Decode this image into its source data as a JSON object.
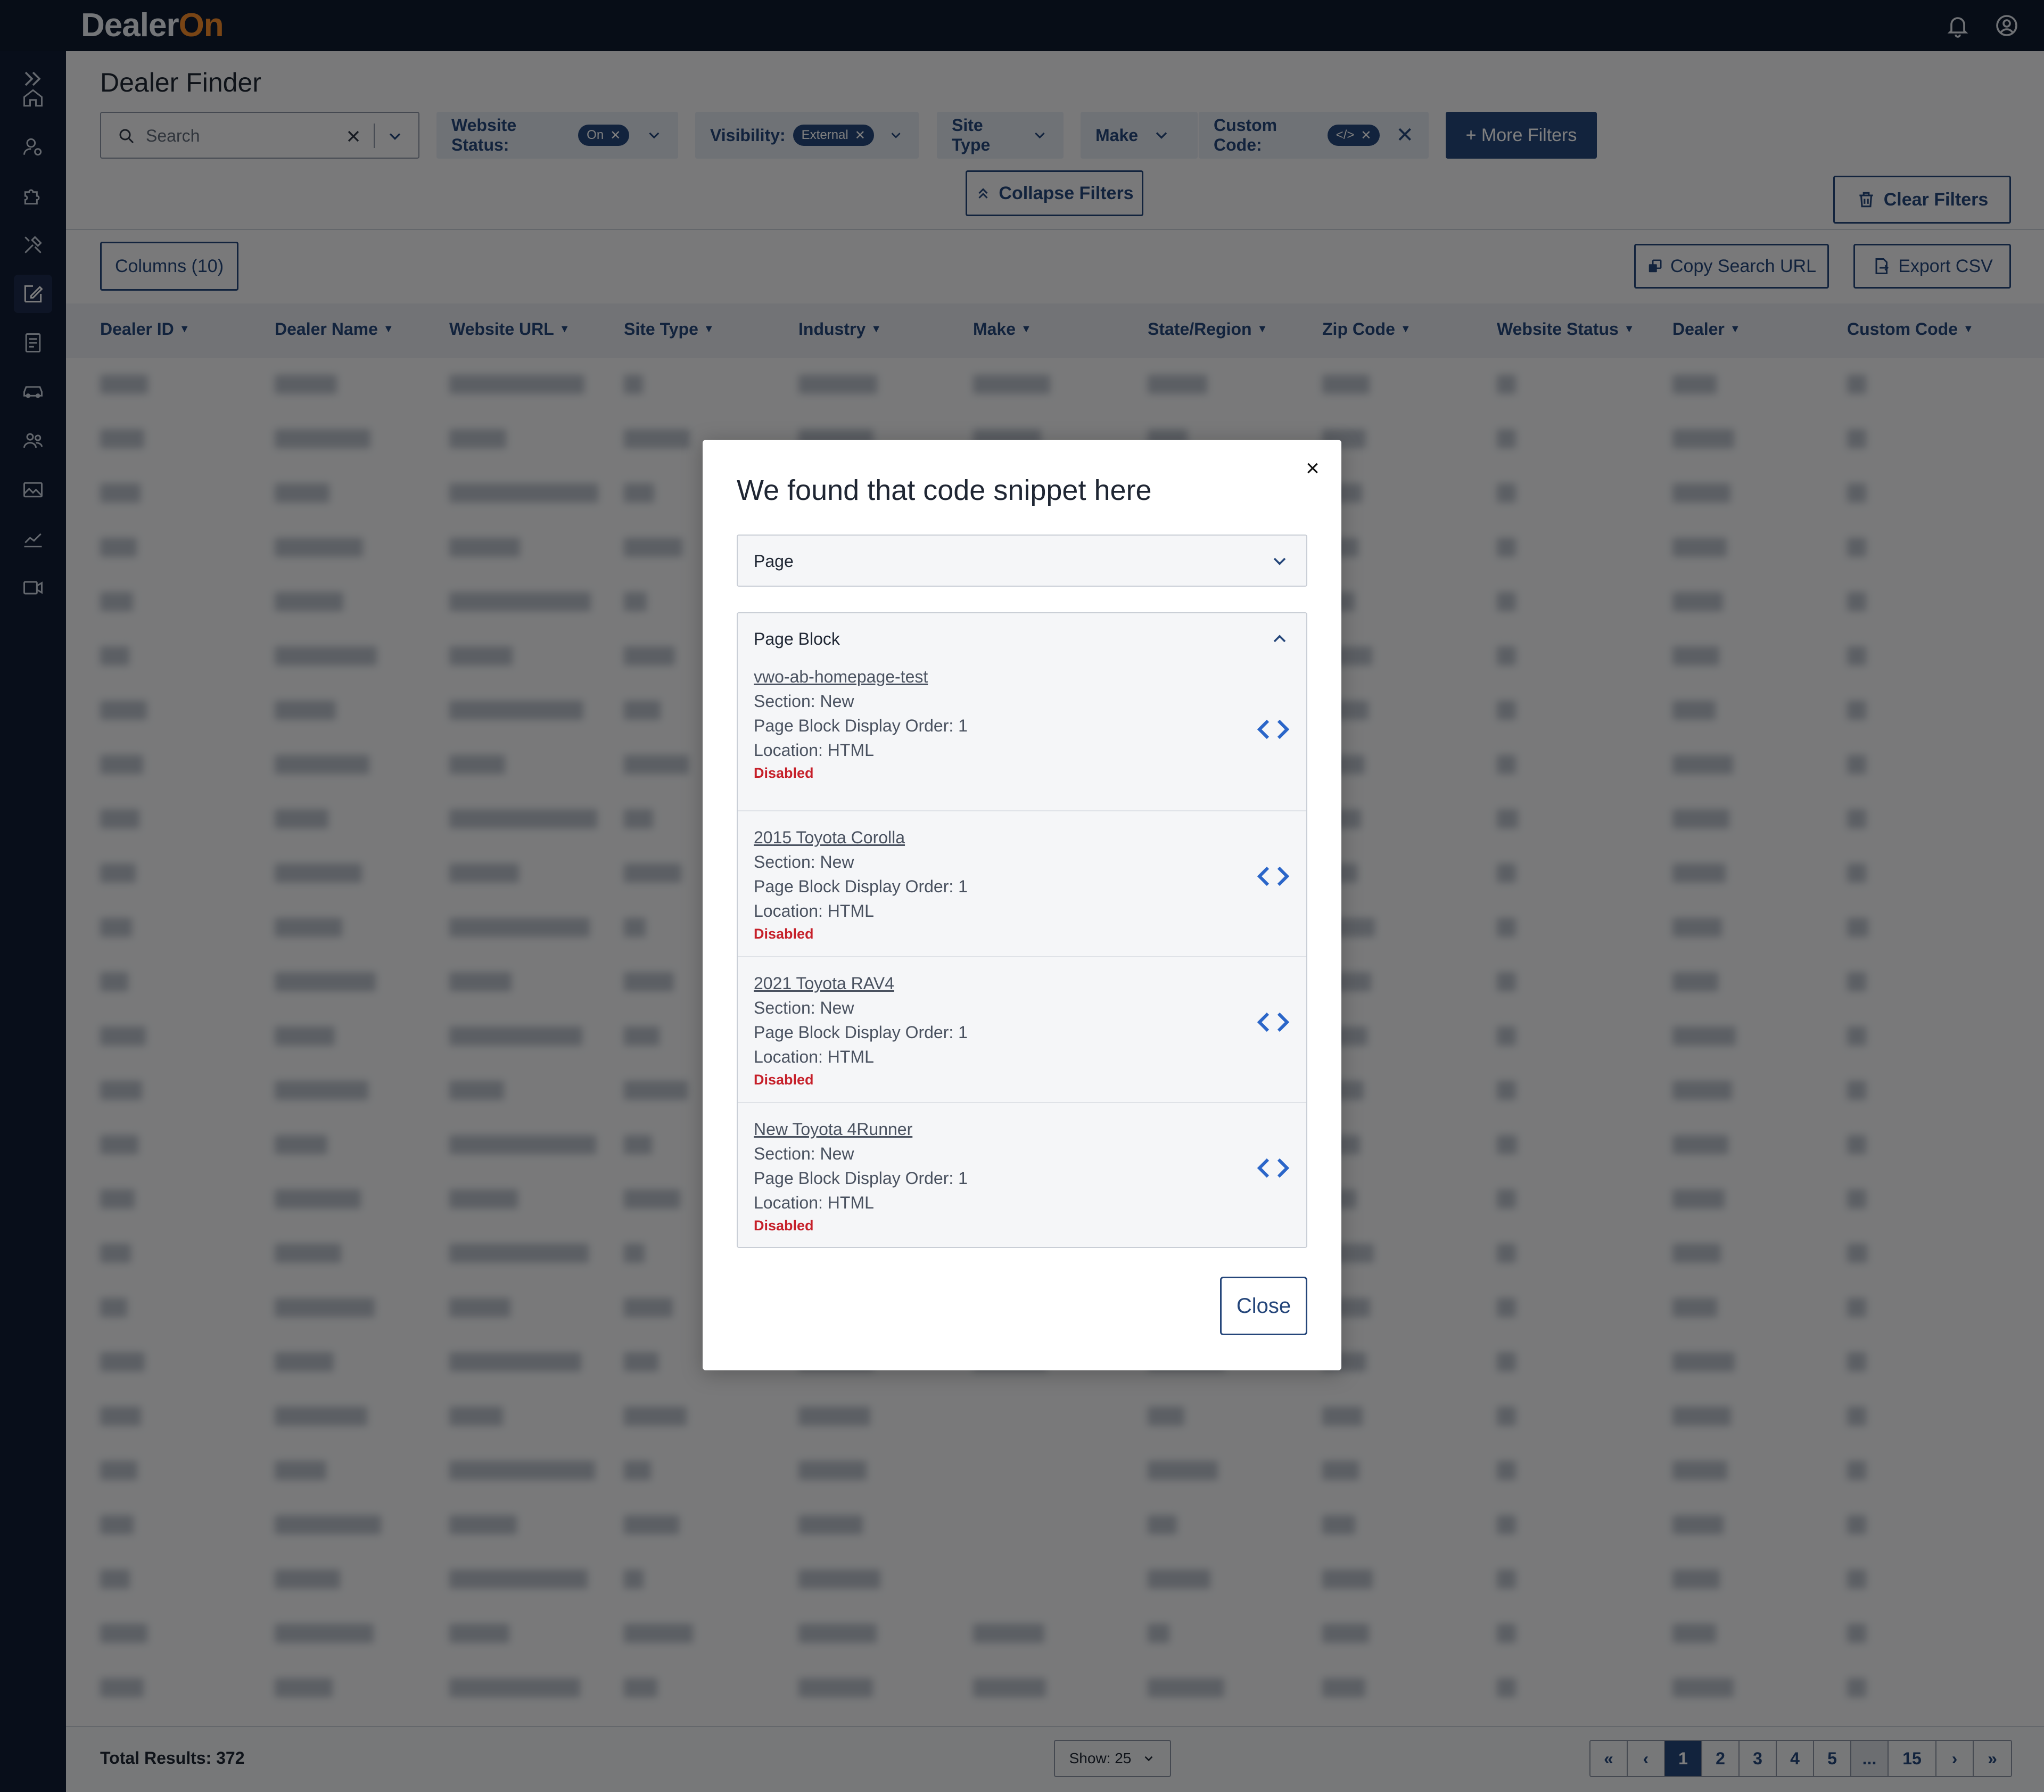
{
  "app": {
    "logo_text_dealer": "Dealer",
    "logo_text_on": "On",
    "accent_color": "#25467a",
    "brand_orange": "#f28b2a",
    "nav_bg": "#111c34"
  },
  "sidebar": {
    "icons": [
      "home-icon",
      "user-settings-icon",
      "puzzle-icon",
      "tools-icon",
      "edit-icon",
      "document-icon",
      "car-icon",
      "users-icon",
      "image-icon",
      "analytics-icon",
      "video-icon"
    ],
    "active_index": 4
  },
  "header": {
    "title": "Dealer Finder",
    "search_placeholder": "Search",
    "filters": {
      "website_status_label": "Website Status:",
      "website_status_value": "On",
      "visibility_label": "Visibility:",
      "visibility_value": "External",
      "site_type_label": "Site Type",
      "make_label": "Make",
      "custom_code_label": "Custom Code:",
      "custom_code_value": "</>"
    },
    "more_filters": "+ More Filters",
    "collapse_filters": "Collapse Filters",
    "clear_filters": "Clear Filters"
  },
  "toolbar": {
    "columns": "Columns (10)",
    "copy_search_url": "Copy Search URL",
    "export_csv": "Export CSV"
  },
  "table": {
    "columns": [
      "Dealer ID",
      "Dealer Name",
      "Website URL",
      "Site Type",
      "Industry",
      "Make",
      "State/Region",
      "Zip Code",
      "Website Status",
      "Dealer",
      "Custom Code"
    ]
  },
  "footer": {
    "total_results": "Total Results: 372",
    "show": "Show: 25",
    "pages": [
      "1",
      "2",
      "3",
      "4",
      "5",
      "...",
      "15"
    ],
    "current_page": "1"
  },
  "modal": {
    "title": "We found that code snippet here",
    "page_accordion": "Page",
    "page_block_accordion": "Page Block",
    "blocks": [
      {
        "name": "vwo-ab-homepage-test",
        "section": "Section: New",
        "order": "Page Block Display Order: 1",
        "location": "Location: HTML",
        "status": "Disabled"
      },
      {
        "name": "2015 Toyota Corolla",
        "section": "Section: New",
        "order": "Page Block Display Order: 1",
        "location": "Location: HTML",
        "status": "Disabled"
      },
      {
        "name": "2021 Toyota RAV4",
        "section": "Section: New",
        "order": "Page Block Display Order: 1",
        "location": "Location: HTML",
        "status": "Disabled"
      },
      {
        "name": "New Toyota 4Runner",
        "section": "Section: New",
        "order": "Page Block Display Order: 1",
        "location": "Location: HTML",
        "status": "Disabled"
      }
    ],
    "close": "Close"
  }
}
